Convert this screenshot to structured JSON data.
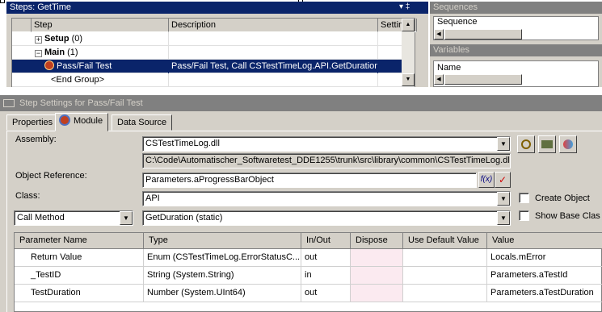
{
  "steps_panel": {
    "title": "Steps: GetTime",
    "pin_glyphs": "▾ ‡",
    "columns": [
      "Step",
      "Description",
      "Settings"
    ],
    "rows": [
      {
        "expander": "+",
        "name": "Setup",
        "count": "(0)",
        "description": "",
        "bold": true
      },
      {
        "expander": "−",
        "name": "Main",
        "count": "(1)",
        "description": "",
        "bold": true
      },
      {
        "name": "Pass/Fail Test",
        "description": "Pass/Fail Test,  Call CSTestTimeLog.API.GetDuration",
        "selected": true
      },
      {
        "name": "<End Group>",
        "description": ""
      }
    ]
  },
  "sequences_panel": {
    "title": "Sequences",
    "column": "Sequence"
  },
  "variables_panel": {
    "title": "Variables",
    "column": "Name"
  },
  "settings": {
    "title": "Step Settings for Pass/Fail Test",
    "tabs": [
      "Properties",
      "Module",
      "Data Source"
    ],
    "active_tab": "Module",
    "assembly_label": "Assembly:",
    "assembly_value": "CSTestTimeLog.dll",
    "assembly_path": "C:\\Code\\Automatischer_Softwaretest_DDE1255\\trunk\\src\\library\\common\\CSTestTimeLog.dll",
    "object_ref_label": "Object Reference:",
    "object_ref_value": "Parameters.aProgressBarObject",
    "fx_label": "f(x)",
    "check_mark": "✓",
    "class_label": "Class:",
    "class_value": "API",
    "create_object_label": "Create Object",
    "call_type_value": "Call Method",
    "method_value": "GetDuration (static)",
    "show_base_class_label": "Show Base Clas"
  },
  "params": {
    "columns": [
      "Parameter Name",
      "Type",
      "In/Out",
      "Dispose",
      "Use Default Value",
      "Value"
    ],
    "rows": [
      {
        "name": "Return Value",
        "type": "Enum (CSTestTimeLog.ErrorStatusC...",
        "inout": "out",
        "value": "Locals.mError"
      },
      {
        "name": "_TestID",
        "type": "String (System.String)",
        "inout": "in",
        "value": "Parameters.aTestId"
      },
      {
        "name": "TestDuration",
        "type": "Number (System.UInt64)",
        "inout": "out",
        "value": "Parameters.aTestDuration"
      }
    ]
  },
  "colors": {
    "active_title": "#0a246a",
    "inactive_title": "#808080",
    "panel": "#d4d0c8",
    "dispose_cell": "#fbeaf0"
  }
}
